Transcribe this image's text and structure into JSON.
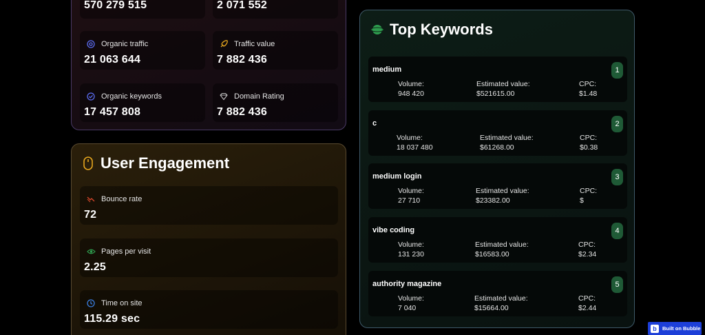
{
  "overview": {
    "top_values": [
      "570 279 515",
      "2 071 552"
    ],
    "organic_traffic": {
      "label": "Organic traffic",
      "value": "21 063 644"
    },
    "traffic_value": {
      "label": "Traffic value",
      "value": "7 882 436"
    },
    "organic_keywords": {
      "label": "Organic keywords",
      "value": "17 457 808"
    },
    "domain_rating": {
      "label": "Domain Rating",
      "value": "7 882 436"
    }
  },
  "engagement": {
    "title": "User Engagement",
    "bounce_rate": {
      "label": "Bounce rate",
      "value": "72"
    },
    "pages_per_visit": {
      "label": "Pages per visit",
      "value": "2.25"
    },
    "time_on_site": {
      "label": "Time on site",
      "value": "115.29 sec"
    }
  },
  "keywords": {
    "title": "Top Keywords",
    "volume_label": "Volume:",
    "estimated_label": "Estimated value:",
    "cpc_label": "CPC:",
    "items": [
      {
        "name": "medium",
        "volume": "948 420",
        "estimated": "$521615.00",
        "cpc": "$1.48",
        "rank": "1"
      },
      {
        "name": "c",
        "volume": "18 037 480",
        "estimated": "$61268.00",
        "cpc": "$0.38",
        "rank": "2"
      },
      {
        "name": "medium login",
        "volume": "27 710",
        "estimated": "$23382.00",
        "cpc": "$",
        "rank": "3"
      },
      {
        "name": "vibe coding",
        "volume": "131 230",
        "estimated": "$16583.00",
        "cpc": "$2.34",
        "rank": "4"
      },
      {
        "name": "authority magazine",
        "volume": "7 040",
        "estimated": "$15664.00",
        "cpc": "$2.44",
        "rank": "5"
      }
    ]
  },
  "badge": {
    "logo": "b",
    "label": "Built on Bubble"
  },
  "colors": {
    "accent_green": "#1f5a36",
    "bubble_blue": "#1d3fd8"
  },
  "icons": {
    "organic_traffic": "target-icon",
    "traffic_value": "rocket-icon",
    "organic_keywords": "check-circle-icon",
    "domain_rating": "diamond-icon",
    "engagement": "mouse-icon",
    "bounce_rate": "trend-down-icon",
    "pages_per_visit": "eye-icon",
    "time_on_site": "clock-icon",
    "keywords": "planet-icon"
  }
}
